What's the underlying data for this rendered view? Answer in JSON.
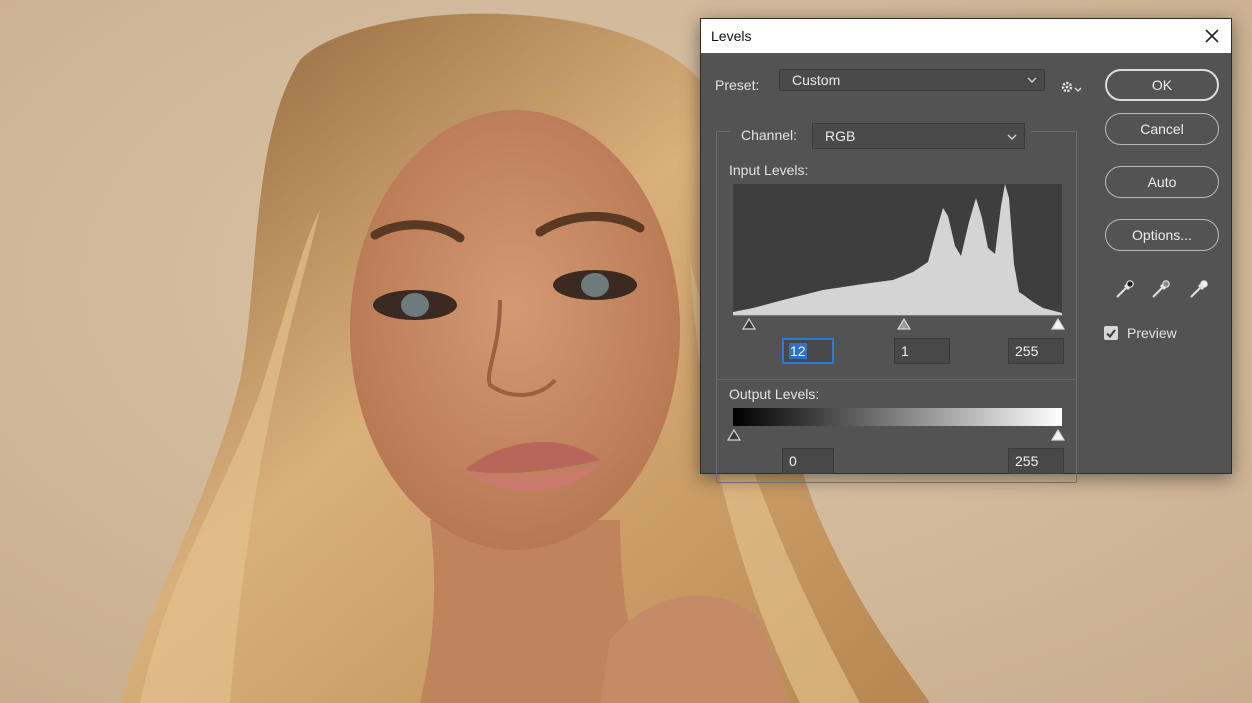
{
  "dialog": {
    "title": "Levels",
    "preset_label": "Preset:",
    "preset_value": "Custom",
    "channel_label": "Channel:",
    "channel_value": "RGB",
    "input_levels_label": "Input Levels:",
    "output_levels_label": "Output Levels:",
    "input_black": "12",
    "input_gamma": "1",
    "input_white": "255",
    "output_black": "0",
    "output_white": "255",
    "buttons": {
      "ok": "OK",
      "cancel": "Cancel",
      "auto": "Auto",
      "options": "Options..."
    },
    "preview_label": "Preview",
    "preview_checked": true
  },
  "colors": {
    "dialog_bg": "#535353",
    "histogram_bg": "#3e3e3e",
    "histogram_fill": "#d4d4d4",
    "focus_blue": "#2f7ad9"
  },
  "icons": {
    "close": "close-icon",
    "preset_dropdown": "chevron-down-icon",
    "channel_dropdown": "chevron-down-icon",
    "preset_options": "gear-icon",
    "black_eyedropper": "eyedropper-black-icon",
    "gray_eyedropper": "eyedropper-gray-icon",
    "white_eyedropper": "eyedropper-white-icon"
  }
}
